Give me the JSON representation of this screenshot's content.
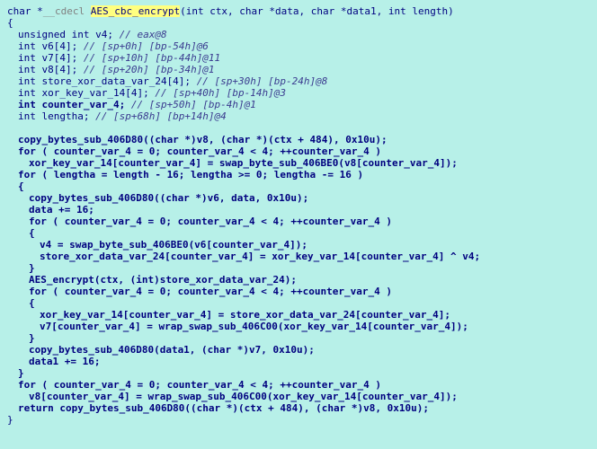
{
  "decl": {
    "ret_ptr": "char *",
    "callconv": "__cdecl ",
    "fn_name": "AES_cbc_encrypt",
    "params": "(int ctx, char *data, char *data1, int length)"
  },
  "vars": {
    "v4": "unsigned int v4; ",
    "v4c": "// eax@8",
    "v6": "int v6[4]; ",
    "v6c": "// [sp+0h] [bp-54h]@6",
    "v7": "int v7[4]; ",
    "v7c": "// [sp+10h] [bp-44h]@11",
    "v8": "int v8[4]; ",
    "v8c": "// [sp+20h] [bp-34h]@1",
    "sxd": "int store_xor_data_var_24[4]; ",
    "sxdc": "// [sp+30h] [bp-24h]@8",
    "xkv": "int xor_key_var_14[4]; ",
    "xkvc": "// [sp+40h] [bp-14h]@3",
    "cv4": "int counter_var_4; ",
    "cv4c": "// [sp+50h] [bp-4h]@1",
    "la": "int lengtha; ",
    "lac": "// [sp+68h] [bp+14h]@4"
  },
  "code": {
    "copy1": "copy_bytes_sub_406D80((char *)v8, (char *)(ctx + 484), 0x10u);",
    "for1": "for ( counter_var_4 = 0; counter_var_4 < 4; ++counter_var_4 )",
    "xkv_swap": "xor_key_var_14[counter_var_4] = swap_byte_sub_406BE0(v8[counter_var_4]);",
    "for_len": "for ( lengtha = length - 16; lengtha >= 0; lengtha -= 16 )",
    "open": "{",
    "close": "}",
    "copy2": "copy_bytes_sub_406D80((char *)v6, data, 0x10u);",
    "data16": "data += 16;",
    "for2": "for ( counter_var_4 = 0; counter_var_4 < 4; ++counter_var_4 )",
    "v4assign": "v4 = swap_byte_sub_406BE0(v6[counter_var_4]);",
    "storexor": "store_xor_data_var_24[counter_var_4] = xor_key_var_14[counter_var_4] ^ v4;",
    "aesenc": "AES_encrypt(ctx, (int)store_xor_data_var_24);",
    "for3": "for ( counter_var_4 = 0; counter_var_4 < 4; ++counter_var_4 )",
    "xkv_s": "xor_key_var_14[counter_var_4] = store_xor_data_var_24[counter_var_4];",
    "v7wrap": "v7[counter_var_4] = wrap_swap_sub_406C00(xor_key_var_14[counter_var_4]);",
    "copy3": "copy_bytes_sub_406D80(data1, (char *)v7, 0x10u);",
    "data1_16": "data1 += 16;",
    "for4": "for ( counter_var_4 = 0; counter_var_4 < 4; ++counter_var_4 )",
    "v8wrap": "v8[counter_var_4] = wrap_swap_sub_406C00(xor_key_var_14[counter_var_4]);",
    "retln": "return copy_bytes_sub_406D80((char *)(ctx + 484), (char *)v8, 0x10u);"
  }
}
